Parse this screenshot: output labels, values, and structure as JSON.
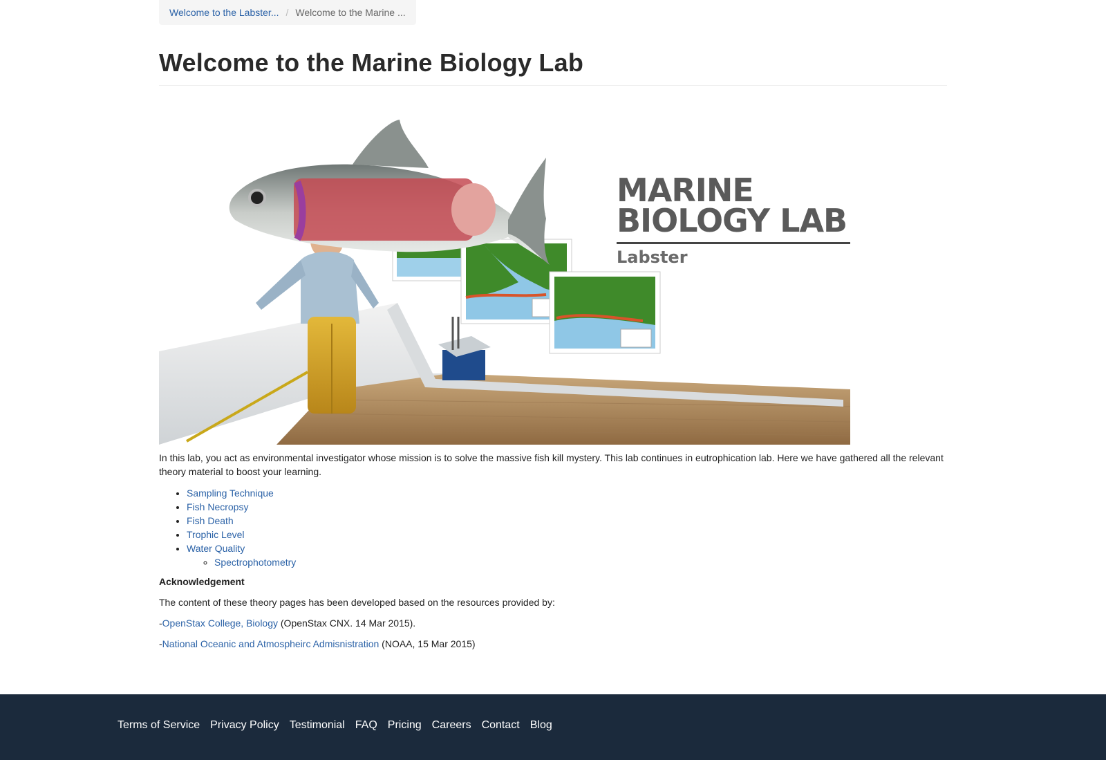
{
  "breadcrumb": {
    "items": [
      {
        "label": "Welcome to the Labster..."
      },
      {
        "label": "Welcome to the Marine ..."
      }
    ]
  },
  "page": {
    "title": "Welcome to the Marine Biology Lab"
  },
  "hero": {
    "title_line1": "MARINE",
    "title_line2": "BIOLOGY LAB",
    "subtitle": "Labster"
  },
  "intro": "In this lab, you act as environmental investigator whose mission is to solve the massive fish kill mystery. This lab continues in eutrophication lab. Here we have gathered all the relevant theory material to boost your learning.",
  "topics": [
    {
      "label": "Sampling Technique"
    },
    {
      "label": "Fish Necropsy"
    },
    {
      "label": "Fish Death"
    },
    {
      "label": "Trophic Level"
    },
    {
      "label": "Water Quality"
    }
  ],
  "subtopics": [
    {
      "label": "Spectrophotometry"
    }
  ],
  "acknowledgement": {
    "heading": "Acknowledgement",
    "text": "The content of these theory pages has been developed based on the resources provided by:",
    "ref1": {
      "prefix": "-",
      "link": "OpenStax College, Biology",
      "suffix": " (OpenStax CNX. 14 Mar 2015)."
    },
    "ref2": {
      "prefix": "-",
      "link": "National Oceanic and Atmospheirc Admisnistration",
      "suffix": " (NOAA, 15 Mar 2015)"
    }
  },
  "footer": {
    "links": [
      {
        "label": "Terms of Service"
      },
      {
        "label": "Privacy Policy"
      },
      {
        "label": "Testimonial"
      },
      {
        "label": "FAQ"
      },
      {
        "label": "Pricing"
      },
      {
        "label": "Careers"
      },
      {
        "label": "Contact"
      },
      {
        "label": "Blog"
      }
    ]
  },
  "colors": {
    "link": "#2b62a7",
    "footer_bg": "#1b2a3c",
    "breadcrumb_bg": "#f5f5f5"
  }
}
